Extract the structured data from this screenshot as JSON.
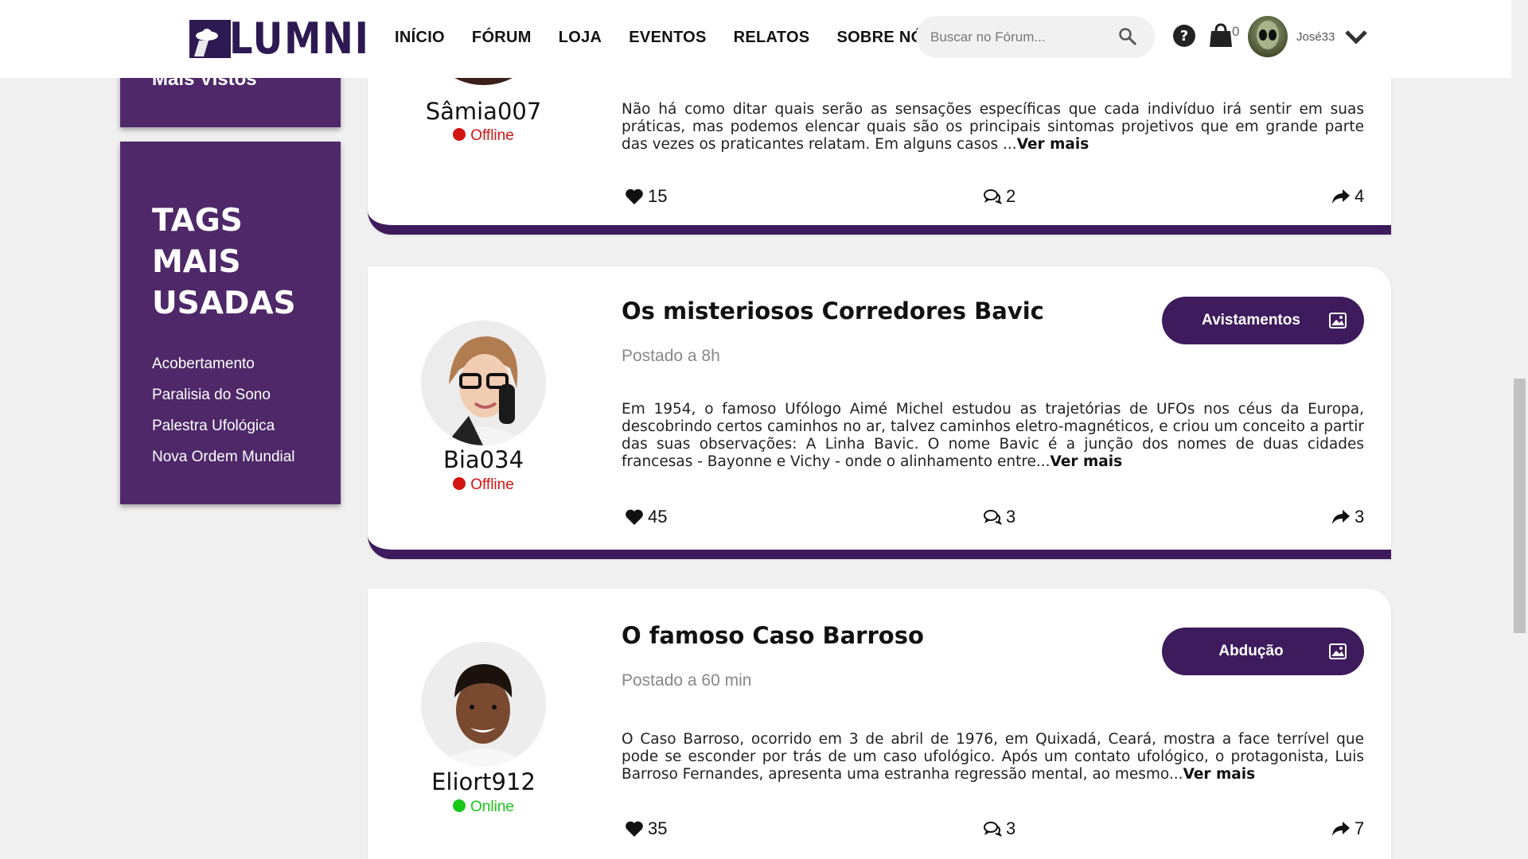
{
  "header": {
    "logo_text": "LUMNI",
    "nav": [
      "INÍCIO",
      "FÓRUM",
      "LOJA",
      "EVENTOS",
      "RELATOS",
      "SOBRE NÓS"
    ],
    "search_placeholder": "Buscar no Fórum...",
    "cart_count": "0",
    "username": "José33"
  },
  "sidebar": {
    "top_label": "Mais Vistos",
    "tags_title": "TAGS MAIS USADAS",
    "tags": [
      "Acobertamento",
      "Paralisia do Sono",
      "Palestra Ufológica",
      "Nova Ordem Mundial"
    ]
  },
  "posts": [
    {
      "username": "Sâmia007",
      "status": "Offline",
      "excerpt": "Não há como ditar quais serão as sensações específicas que cada indivíduo irá sentir em suas práticas, mas podemos elencar quais são os principais sintomas projetivos que em grande parte das vezes os praticantes relatam. Em alguns casos ...",
      "more": "Ver mais",
      "likes": "15",
      "comments": "2",
      "shares": "4"
    },
    {
      "username": "Bia034",
      "status": "Offline",
      "title": "Os misteriosos Corredores Bavic",
      "posted": "Postado a 8h",
      "tag": "Avistamentos",
      "excerpt": "Em 1954, o famoso Ufólogo Aimé Michel estudou as trajetórias de UFOs nos céus da Europa, descobrindo certos caminhos no ar, talvez caminhos eletro-magnéticos, e criou um conceito a partir das suas observações: A Linha Bavic. O nome Bavic é a junção dos nomes de duas cidades francesas - Bayonne e Vichy - onde o alinhamento entre...",
      "more": "Ver mais",
      "likes": "45",
      "comments": "3",
      "shares": "3"
    },
    {
      "username": "Eliort912",
      "status": "Online",
      "title": "O famoso Caso Barroso",
      "posted": "Postado a 60 min",
      "tag": "Abdução",
      "excerpt": "O Caso Barroso, ocorrido em 3 de abril de 1976, em Quixadá, Ceará, mostra a face terrível que pode se esconder por trás de um caso ufológico. Após um contato ufológico, o protagonista, Luis Barroso Fernandes, apresenta uma estranha regressão mental, ao mesmo...",
      "more": "Ver mais",
      "likes": "35",
      "comments": "3",
      "shares": "7"
    }
  ],
  "colors": {
    "brand_purple": "#3e1b5c",
    "sidebar_purple": "#4e2868",
    "offline": "#d31414",
    "online": "#18c818"
  }
}
